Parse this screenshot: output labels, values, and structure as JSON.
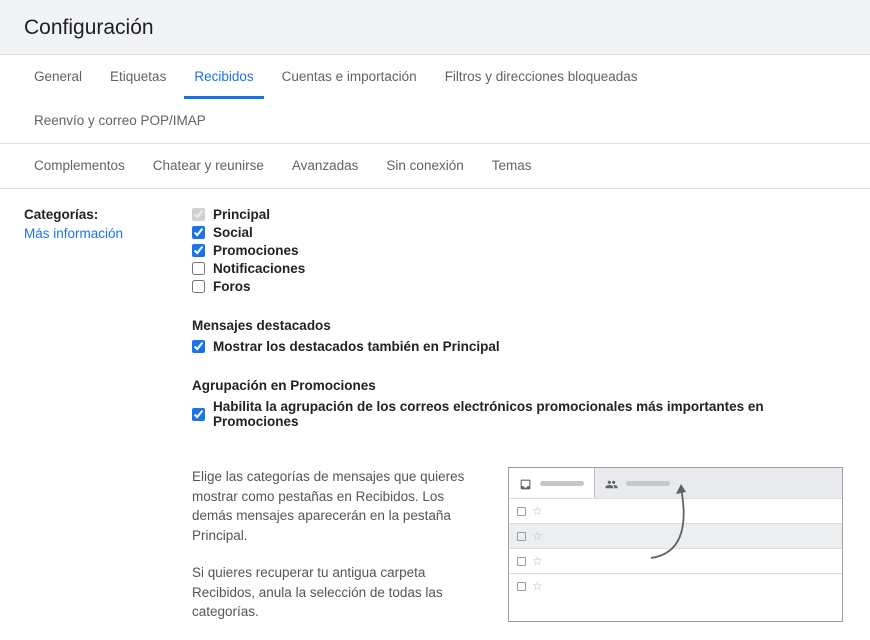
{
  "header": {
    "title": "Configuración"
  },
  "tabs": {
    "row1": [
      "General",
      "Etiquetas",
      "Recibidos",
      "Cuentas e importación",
      "Filtros y direcciones bloqueadas",
      "Reenvío y correo POP/IMAP"
    ],
    "row2": [
      "Complementos",
      "Chatear y reunirse",
      "Avanzadas",
      "Sin conexión",
      "Temas"
    ],
    "active": "Recibidos"
  },
  "section": {
    "label": "Categorías:",
    "learn_more": "Más información"
  },
  "categories": [
    {
      "label": "Principal",
      "checked": true,
      "disabled": true
    },
    {
      "label": "Social",
      "checked": true,
      "disabled": false
    },
    {
      "label": "Promociones",
      "checked": true,
      "disabled": false
    },
    {
      "label": "Notificaciones",
      "checked": false,
      "disabled": false
    },
    {
      "label": "Foros",
      "checked": false,
      "disabled": false
    }
  ],
  "starred": {
    "heading": "Mensajes destacados",
    "label": "Mostrar los destacados también en Principal",
    "checked": true
  },
  "promo_group": {
    "heading": "Agrupación en Promociones",
    "label": "Habilita la agrupación de los correos electrónicos promocionales más importantes en Promociones",
    "checked": true
  },
  "description": {
    "p1": "Elige las categorías de mensajes que quieres mostrar como pestañas en Recibidos. Los demás mensajes aparecerán en la pestaña Principal.",
    "p2": "Si quieres recuperar tu antigua carpeta Recibidos, anula la selección de todas las categorías."
  }
}
